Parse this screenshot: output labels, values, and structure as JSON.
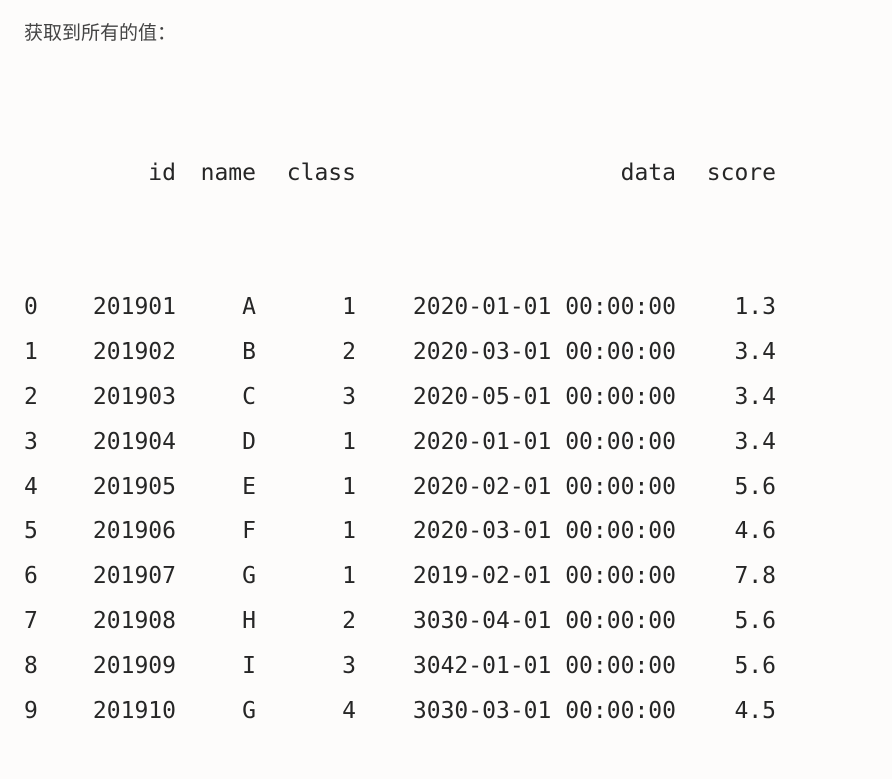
{
  "title": "获取到所有的值：",
  "headers": {
    "idx": "",
    "id": "id",
    "name": "name",
    "class": "class",
    "data": "data",
    "score": "score"
  },
  "rows": [
    {
      "idx": "0",
      "id": "201901",
      "name": "A",
      "class": "1",
      "data": "2020-01-01 00:00:00",
      "score": "1.3"
    },
    {
      "idx": "1",
      "id": "201902",
      "name": "B",
      "class": "2",
      "data": "2020-03-01 00:00:00",
      "score": "3.4"
    },
    {
      "idx": "2",
      "id": "201903",
      "name": "C",
      "class": "3",
      "data": "2020-05-01 00:00:00",
      "score": "3.4"
    },
    {
      "idx": "3",
      "id": "201904",
      "name": "D",
      "class": "1",
      "data": "2020-01-01 00:00:00",
      "score": "3.4"
    },
    {
      "idx": "4",
      "id": "201905",
      "name": "E",
      "class": "1",
      "data": "2020-02-01 00:00:00",
      "score": "5.6"
    },
    {
      "idx": "5",
      "id": "201906",
      "name": "F",
      "class": "1",
      "data": "2020-03-01 00:00:00",
      "score": "4.6"
    },
    {
      "idx": "6",
      "id": "201907",
      "name": "G",
      "class": "1",
      "data": "2019-02-01 00:00:00",
      "score": "7.8"
    },
    {
      "idx": "7",
      "id": "201908",
      "name": "H",
      "class": "2",
      "data": "3030-04-01 00:00:00",
      "score": "5.6"
    },
    {
      "idx": "8",
      "id": "201909",
      "name": "I",
      "class": "3",
      "data": "3042-01-01 00:00:00",
      "score": "5.6"
    },
    {
      "idx": "9",
      "id": "201910",
      "name": "G",
      "class": "4",
      "data": "3030-03-01 00:00:00",
      "score": "4.5"
    }
  ],
  "chart_data": {
    "type": "table",
    "title": "获取到所有的值：",
    "columns": [
      "",
      "id",
      "name",
      "class",
      "data",
      "score"
    ],
    "data": [
      [
        0,
        201901,
        "A",
        1,
        "2020-01-01 00:00:00",
        1.3
      ],
      [
        1,
        201902,
        "B",
        2,
        "2020-03-01 00:00:00",
        3.4
      ],
      [
        2,
        201903,
        "C",
        3,
        "2020-05-01 00:00:00",
        3.4
      ],
      [
        3,
        201904,
        "D",
        1,
        "2020-01-01 00:00:00",
        3.4
      ],
      [
        4,
        201905,
        "E",
        1,
        "2020-02-01 00:00:00",
        5.6
      ],
      [
        5,
        201906,
        "F",
        1,
        "2020-03-01 00:00:00",
        4.6
      ],
      [
        6,
        201907,
        "G",
        1,
        "2019-02-01 00:00:00",
        7.8
      ],
      [
        7,
        201908,
        "H",
        2,
        "3030-04-01 00:00:00",
        5.6
      ],
      [
        8,
        201909,
        "I",
        3,
        "3042-01-01 00:00:00",
        5.6
      ],
      [
        9,
        201910,
        "G",
        4,
        "3030-03-01 00:00:00",
        4.5
      ]
    ]
  }
}
